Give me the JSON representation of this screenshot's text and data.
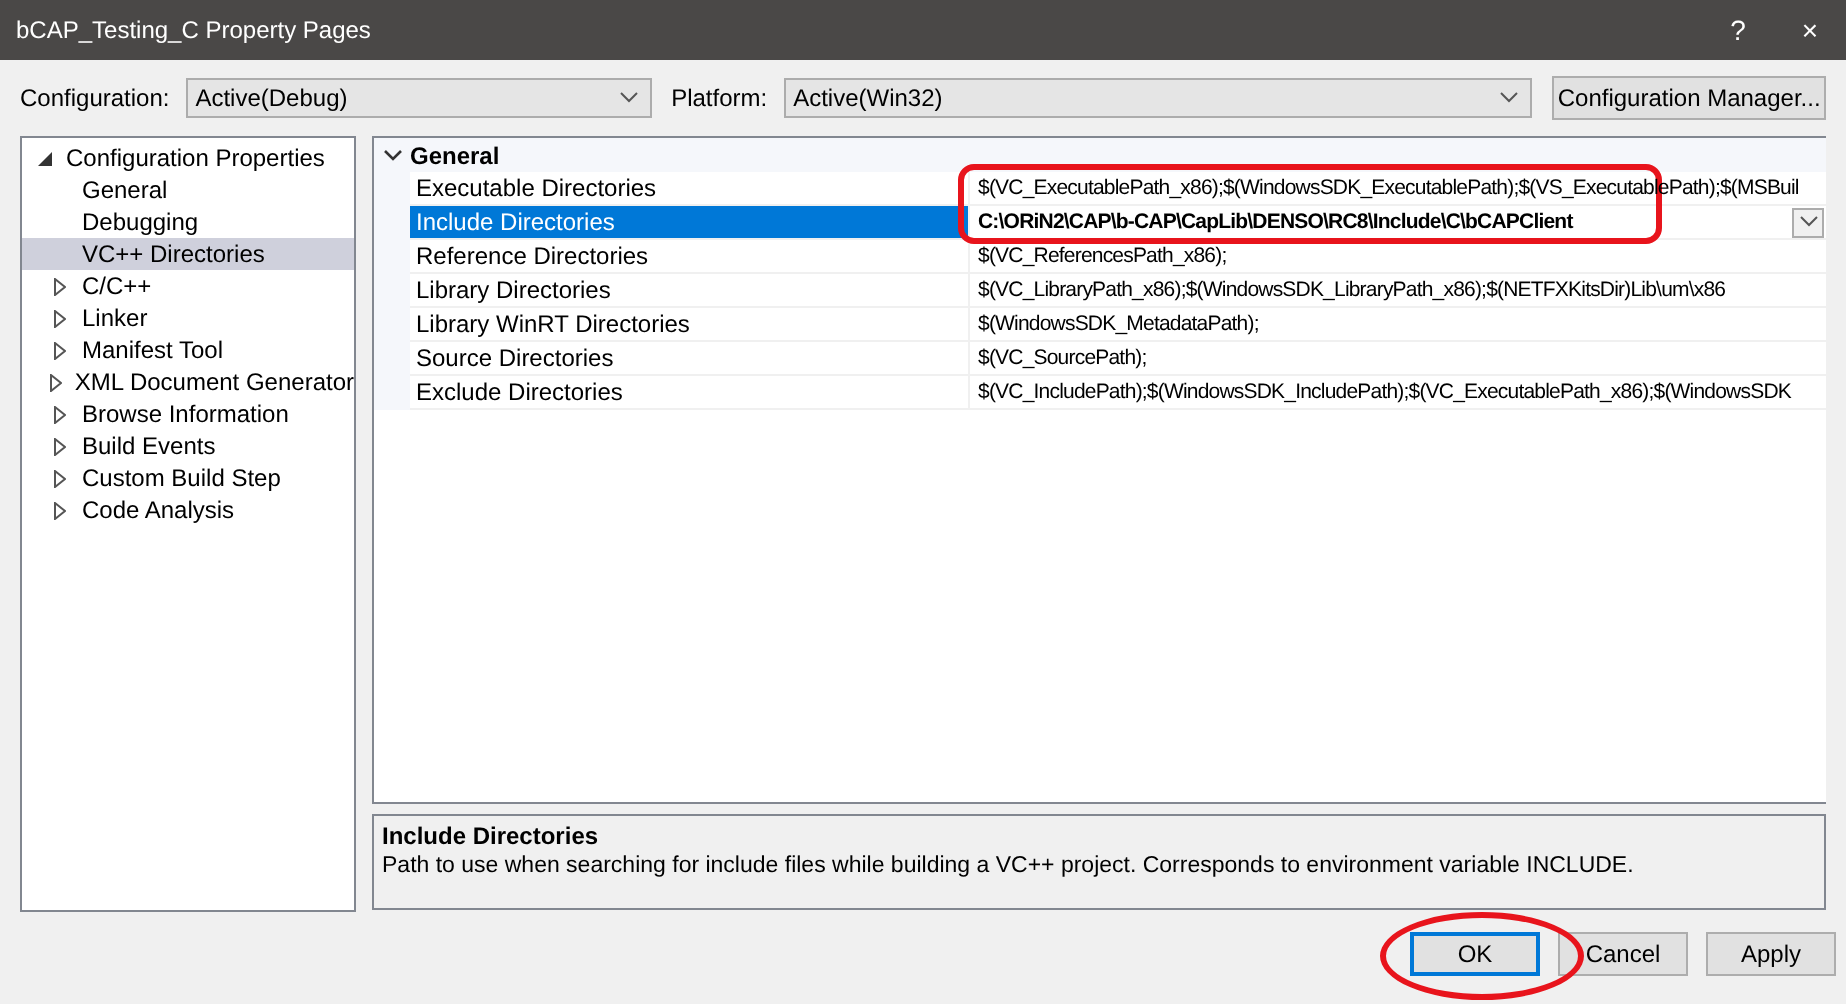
{
  "window": {
    "title": "bCAP_Testing_C Property Pages",
    "help_button": "?",
    "close_button": "×"
  },
  "configuration": {
    "label": "Configuration:",
    "value": "Active(Debug)"
  },
  "platform": {
    "label": "Platform:",
    "value": "Active(Win32)"
  },
  "configuration_manager_button": "Configuration Manager...",
  "tree": [
    {
      "label": "Configuration Properties",
      "expanded": true,
      "selected": false,
      "children": [
        {
          "label": "General",
          "selected": false
        },
        {
          "label": "Debugging",
          "selected": false
        },
        {
          "label": "VC++ Directories",
          "selected": true
        },
        {
          "label": "C/C++",
          "expanded": false,
          "selected": false
        },
        {
          "label": "Linker",
          "expanded": false,
          "selected": false
        },
        {
          "label": "Manifest Tool",
          "expanded": false,
          "selected": false
        },
        {
          "label": "XML Document Generator",
          "expanded": false,
          "selected": false
        },
        {
          "label": "Browse Information",
          "expanded": false,
          "selected": false
        },
        {
          "label": "Build Events",
          "expanded": false,
          "selected": false
        },
        {
          "label": "Custom Build Step",
          "expanded": false,
          "selected": false
        },
        {
          "label": "Code Analysis",
          "expanded": false,
          "selected": false
        }
      ]
    }
  ],
  "grid": {
    "category": {
      "label": "General",
      "expanded": true
    },
    "rows": [
      {
        "name": "Executable Directories",
        "value": "$(VC_ExecutablePath_x86);$(WindowsSDK_ExecutablePath);$(VS_ExecutablePath);$(MSBuil",
        "selected": false,
        "modified": false
      },
      {
        "name": "Include Directories",
        "value": "C:\\ORiN2\\CAP\\b-CAP\\CapLib\\DENSO\\RC8\\Include\\C\\bCAPClient",
        "selected": true,
        "modified": true
      },
      {
        "name": "Reference Directories",
        "value": "$(VC_ReferencesPath_x86);",
        "selected": false,
        "modified": false
      },
      {
        "name": "Library Directories",
        "value": "$(VC_LibraryPath_x86);$(WindowsSDK_LibraryPath_x86);$(NETFXKitsDir)Lib\\um\\x86",
        "selected": false,
        "modified": false
      },
      {
        "name": "Library WinRT Directories",
        "value": "$(WindowsSDK_MetadataPath);",
        "selected": false,
        "modified": false
      },
      {
        "name": "Source Directories",
        "value": "$(VC_SourcePath);",
        "selected": false,
        "modified": false
      },
      {
        "name": "Exclude Directories",
        "value": "$(VC_IncludePath);$(WindowsSDK_IncludePath);$(VC_ExecutablePath_x86);$(WindowsSDK",
        "selected": false,
        "modified": false
      }
    ]
  },
  "description": {
    "title": "Include Directories",
    "text": "Path to use when searching for include files while building a VC++ project.  Corresponds to environment variable INCLUDE."
  },
  "buttons": [
    {
      "label": "OK",
      "default": true
    },
    {
      "label": "Cancel",
      "default": false
    },
    {
      "label": "Apply",
      "default": false
    }
  ]
}
